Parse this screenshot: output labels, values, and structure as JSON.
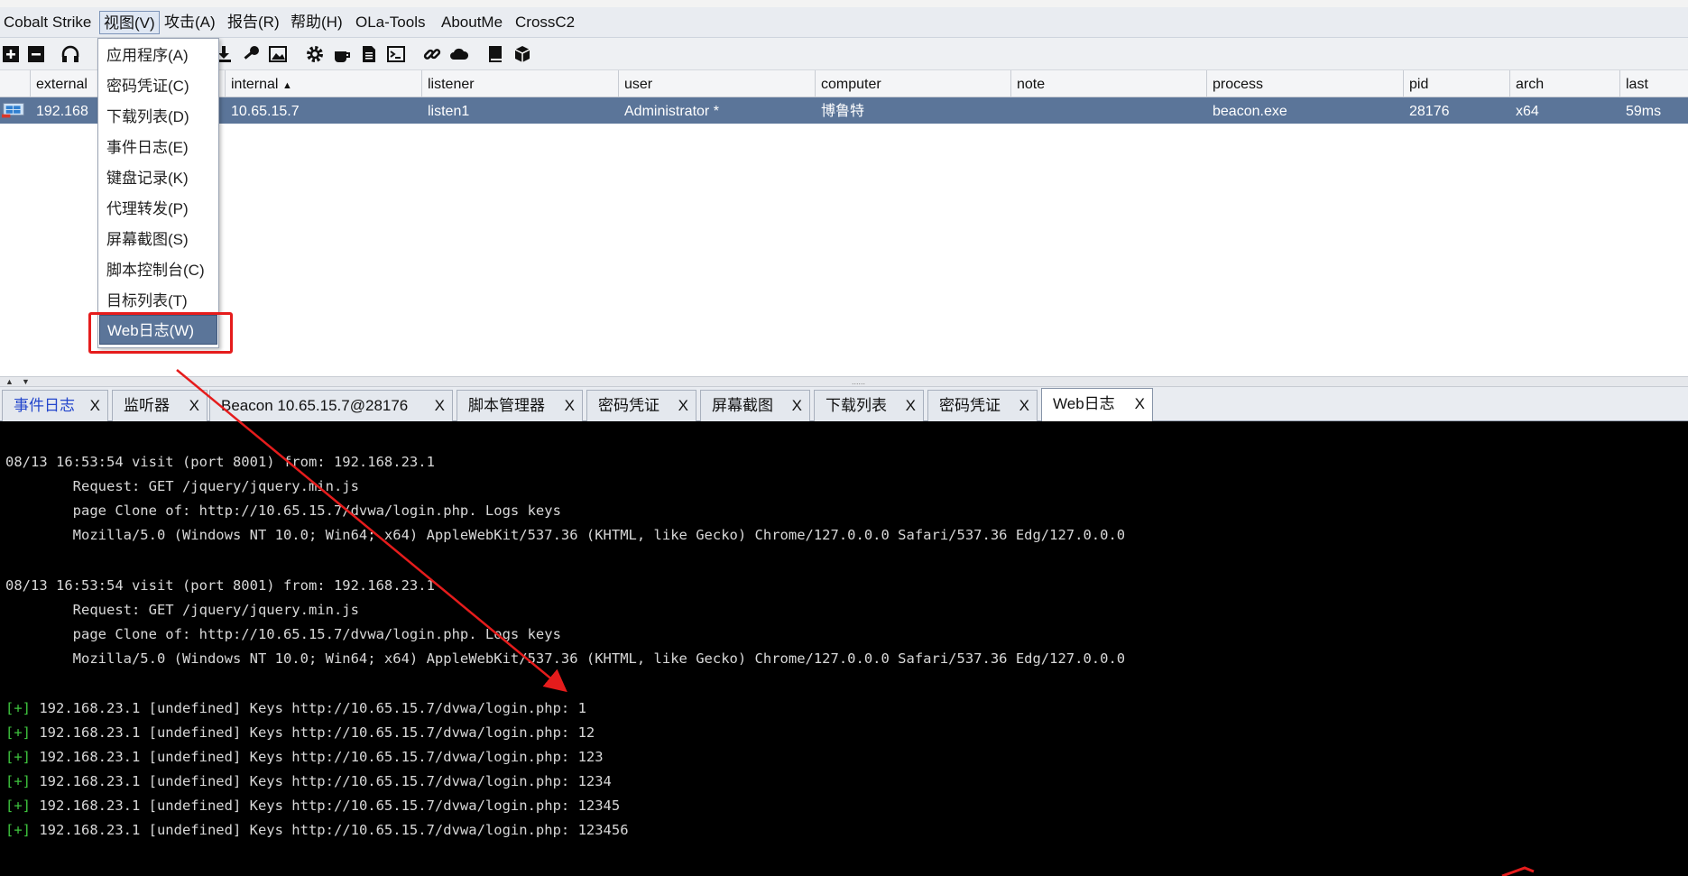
{
  "menubar": {
    "items": [
      "Cobalt Strike",
      "视图(V)",
      "攻击(A)",
      "报告(R)",
      "帮助(H)",
      "OLa-Tools",
      "AboutMe",
      "CrossC2"
    ]
  },
  "toolbar": {
    "icons": [
      "plus-icon",
      "minus-icon",
      "headphones-icon",
      "download-icon",
      "key-icon",
      "image-icon",
      "gear-icon",
      "coffee-icon",
      "document-icon",
      "terminal-icon",
      "link-icon",
      "cloud-icon",
      "book-icon",
      "package-icon"
    ]
  },
  "table": {
    "columns": [
      "external",
      "internal",
      "listener",
      "user",
      "computer",
      "note",
      "process",
      "pid",
      "arch",
      "last"
    ],
    "sort_indicator": "▲",
    "rows": [
      {
        "external": "192.168",
        "internal": "10.65.15.7",
        "listener": "listen1",
        "user": "Administrator *",
        "computer": "博鲁特",
        "note": "",
        "process": "beacon.exe",
        "pid": "28176",
        "arch": "x64",
        "last": "59ms"
      }
    ]
  },
  "view_menu": {
    "items": [
      "应用程序(A)",
      "密码凭证(C)",
      "下载列表(D)",
      "事件日志(E)",
      "键盘记录(K)",
      "代理转发(P)",
      "屏幕截图(S)",
      "脚本控制台(C)",
      "目标列表(T)",
      "Web日志(W)"
    ],
    "selected_index": 9
  },
  "splitter": {
    "up": "▲",
    "down": "▼",
    "grip": "......"
  },
  "tabs": [
    {
      "label": "事件日志",
      "close": "X"
    },
    {
      "label": "监听器",
      "close": "X"
    },
    {
      "label": "Beacon 10.65.15.7@28176",
      "close": "X"
    },
    {
      "label": "脚本管理器",
      "close": "X"
    },
    {
      "label": "密码凭证",
      "close": "X"
    },
    {
      "label": "屏幕截图",
      "close": "X"
    },
    {
      "label": "下载列表",
      "close": "X"
    },
    {
      "label": "密码凭证",
      "close": "X"
    },
    {
      "label": "Web日志",
      "close": "X"
    }
  ],
  "console": {
    "lines": [
      "08/13 16:53:54 visit (port 8001) from: 192.168.23.1",
      "        Request: GET /jquery/jquery.min.js",
      "        page Clone of: http://10.65.15.7/dvwa/login.php. Logs keys",
      "        Mozilla/5.0 (Windows NT 10.0; Win64; x64) AppleWebKit/537.36 (KHTML, like Gecko) Chrome/127.0.0.0 Safari/537.36 Edg/127.0.0.0",
      "08/13 16:53:54 visit (port 8001) from: 192.168.23.1",
      "        Request: GET /jquery/jquery.min.js",
      "        page Clone of: http://10.65.15.7/dvwa/login.php. Logs keys",
      "        Mozilla/5.0 (Windows NT 10.0; Win64; x64) AppleWebKit/537.36 (KHTML, like Gecko) Chrome/127.0.0.0 Safari/537.36 Edg/127.0.0.0"
    ],
    "key_prefix": "[+]",
    "key_lines": [
      " 192.168.23.1 [undefined] Keys http://10.65.15.7/dvwa/login.php: 1",
      " 192.168.23.1 [undefined] Keys http://10.65.15.7/dvwa/login.php: 12",
      " 192.168.23.1 [undefined] Keys http://10.65.15.7/dvwa/login.php: 123",
      " 192.168.23.1 [undefined] Keys http://10.65.15.7/dvwa/login.php: 1234",
      " 192.168.23.1 [undefined] Keys http://10.65.15.7/dvwa/login.php: 12345",
      " 192.168.23.1 [undefined] Keys http://10.65.15.7/dvwa/login.php: 123456"
    ]
  },
  "colors": {
    "selected_row": "#5b7599",
    "annotation_red": "#e51c1c",
    "console_bg": "#000000",
    "console_green": "#3ec43e",
    "active_tab_label_blue": "#2346cc"
  }
}
